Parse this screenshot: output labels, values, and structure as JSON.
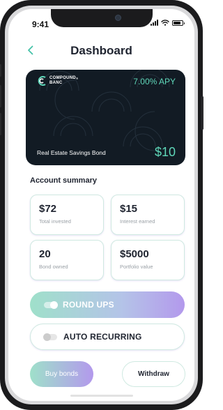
{
  "status_bar": {
    "time": "9:41",
    "battery_level": 0.85
  },
  "header": {
    "back_icon": "chevron-left-icon",
    "title": "Dashboard"
  },
  "card": {
    "logo_line1": "COMPOUND",
    "logo_line2": "BANC",
    "logo_mark": "®",
    "apy": "7.00% APY",
    "product_name": "Real Estate Savings Bond",
    "balance": "$10",
    "accent_color": "#5fd7b9",
    "background_color": "#121b24"
  },
  "summary": {
    "title": "Account summary",
    "stats": [
      {
        "value": "$72",
        "label": "Total invested"
      },
      {
        "value": "$15",
        "label": "Interest earned"
      },
      {
        "value": "20",
        "label": "Bond owned"
      },
      {
        "value": "$5000",
        "label": "Portfolio value"
      }
    ]
  },
  "toggles": [
    {
      "label": "ROUND UPS",
      "on": true
    },
    {
      "label": "AUTO RECURRING",
      "on": false
    }
  ],
  "actions": {
    "buy_label": "Buy bonds",
    "withdraw_label": "Withdraw"
  },
  "colors": {
    "accent": "#45c2a8",
    "gradient_start": "#9fe0ca",
    "gradient_end": "#b399ec"
  }
}
